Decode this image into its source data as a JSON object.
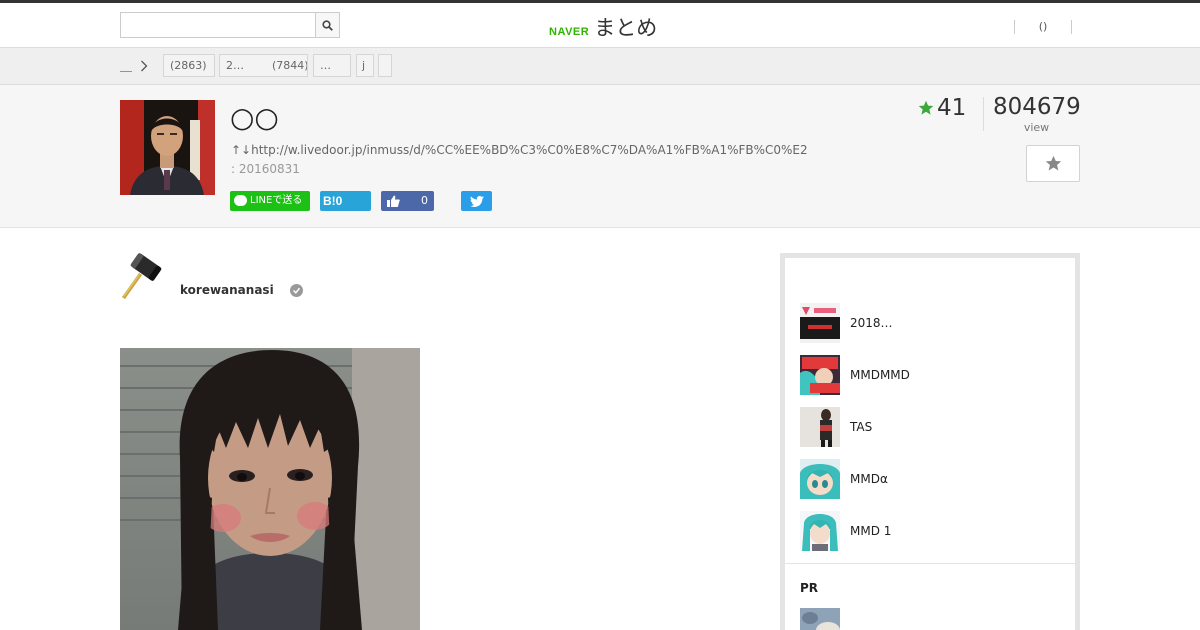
{
  "header": {
    "search_placeholder": "",
    "logo_naver": "NAVER",
    "logo_matome": "まとめ",
    "user_link": "()"
  },
  "breadcrumb": {
    "home": "＿",
    "chips": [
      {
        "label": "(2863)"
      },
      {
        "label": "2…        (7844)"
      },
      {
        "label": "…"
      },
      {
        "label": "j"
      },
      {
        "label": ""
      }
    ]
  },
  "article": {
    "title": "○○",
    "source": "↑↓http://w.livedoor.jp/inmuss/d/%CC%EE%BD%C3%C0%E8%C7%DA%A1%FB%A1%FB%C0%E2",
    "date": ": 20160831",
    "favorites": "41",
    "views": "804679",
    "views_label": "view"
  },
  "share": {
    "line_label": "LINEで送る",
    "hatena_label": "B!",
    "hatena_count": "0",
    "facebook_count": "0"
  },
  "author": {
    "name": "korewananasi"
  },
  "sidebar": {
    "items": [
      {
        "title": "2018…"
      },
      {
        "title": "MMDMMD"
      },
      {
        "title": "TAS"
      },
      {
        "title": "MMDα"
      },
      {
        "title": "MMD 1"
      }
    ],
    "pr_label": "PR"
  },
  "colors": {
    "brand_green": "#2db400",
    "line_green": "#1dc116",
    "hatena_blue": "#28a4d9",
    "facebook_blue": "#4c68a8",
    "twitter_blue": "#2a9ee8",
    "star_green": "#3aa83a"
  }
}
